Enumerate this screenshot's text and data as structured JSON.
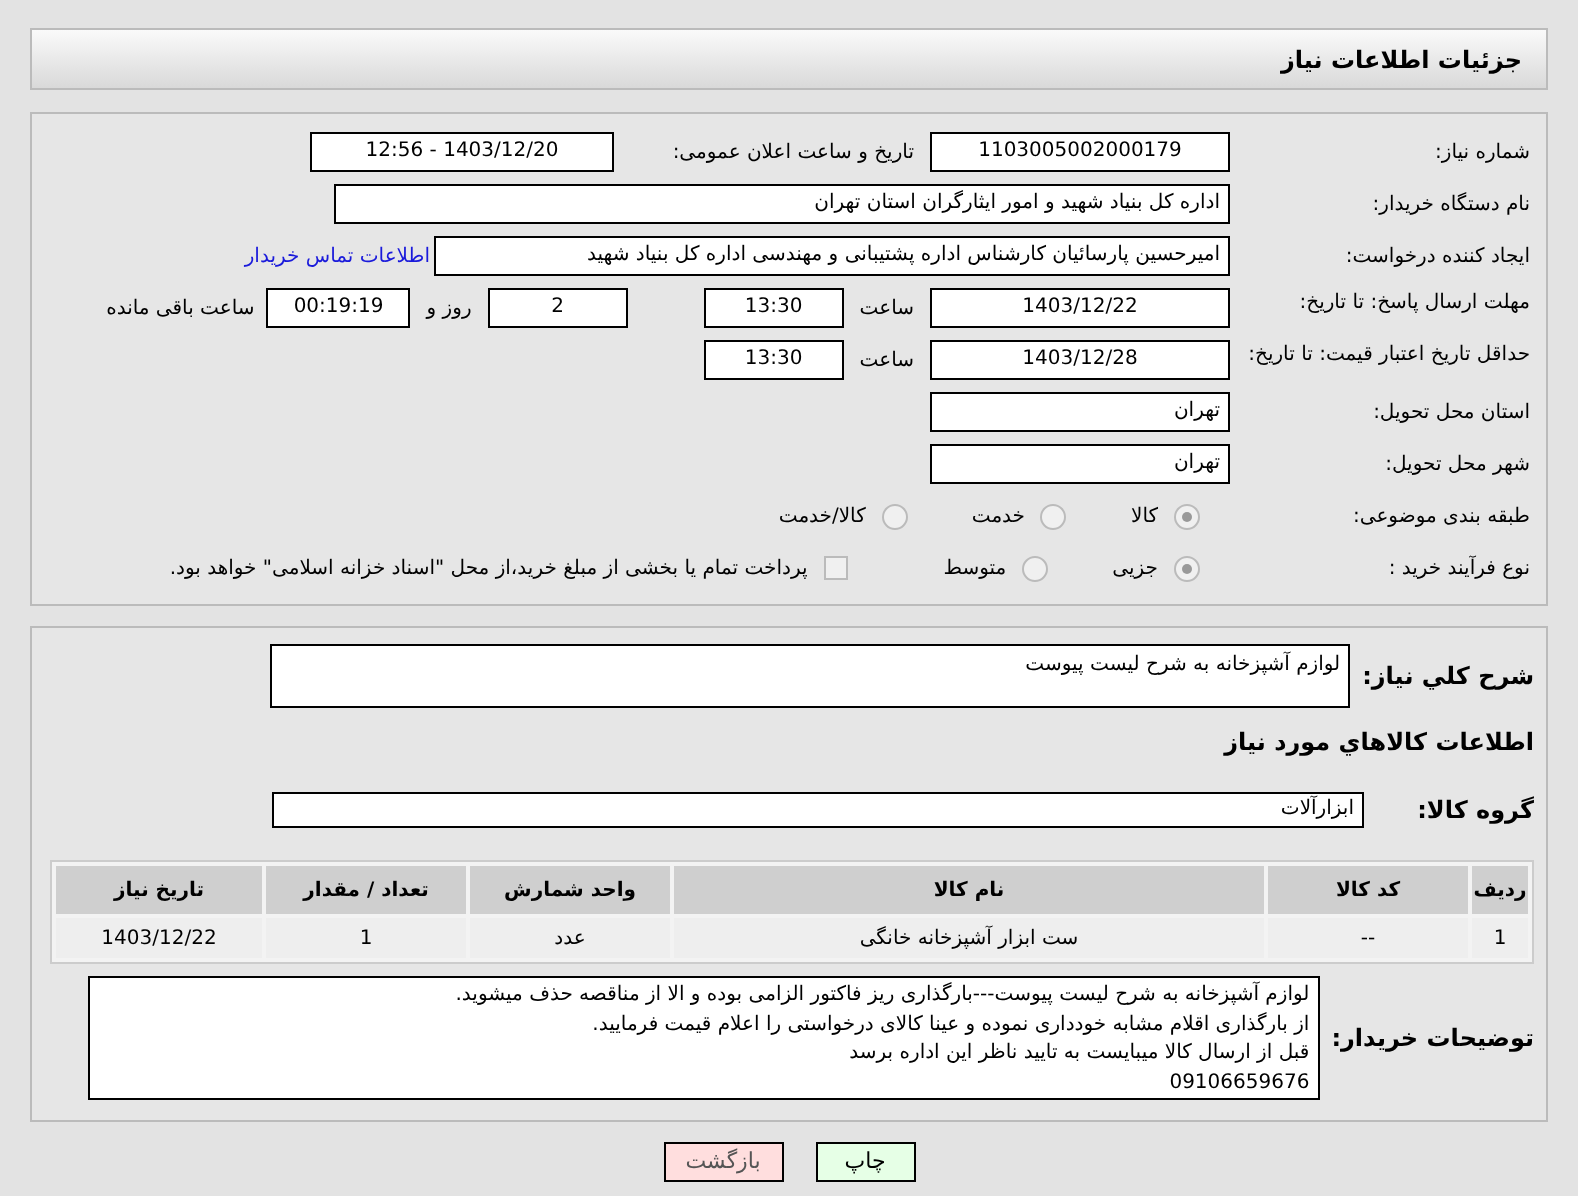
{
  "header": {
    "title": "جزئیات اطلاعات نیاز"
  },
  "need_number": {
    "label": "شماره نیاز:",
    "value": "1103005002000179"
  },
  "announce": {
    "label": "تاریخ و ساعت اعلان عمومی:",
    "value": "1403/12/20 - 12:56"
  },
  "buyer": {
    "label": "نام دستگاه خریدار:",
    "value": "اداره کل بنیاد شهید و امور ایثارگران استان تهران"
  },
  "creator": {
    "label": "ایجاد کننده درخواست:",
    "value": "امیرحسین پارسائیان کارشناس اداره پشتیبانی و مهندسی  اداره کل بنیاد شهید",
    "link": "اطلاعات تماس خریدار"
  },
  "reply_deadline": {
    "label": "مهلت ارسال پاسخ: تا تاریخ:",
    "date": "1403/12/22",
    "time_label": "ساعت",
    "time": "13:30",
    "days": "2",
    "days_label": "روز و",
    "remaining": "00:19:19",
    "remaining_label": "ساعت باقی مانده"
  },
  "price_validity": {
    "label": "حداقل تاریخ اعتبار قیمت: تا تاریخ:",
    "date": "1403/12/28",
    "time_label": "ساعت",
    "time": "13:30"
  },
  "province": {
    "label": "استان محل تحویل:",
    "value": "تهران"
  },
  "city": {
    "label": "شهر محل تحویل:",
    "value": "تهران"
  },
  "category": {
    "label": "طبقه بندی موضوعی:",
    "options": [
      {
        "label": "کالا",
        "selected": true
      },
      {
        "label": "خدمت",
        "selected": false
      },
      {
        "label": "کالا/خدمت",
        "selected": false
      }
    ]
  },
  "purchase_process": {
    "label": "نوع فرآیند خرید :",
    "options": [
      {
        "label": "جزیی",
        "selected": true
      },
      {
        "label": "متوسط",
        "selected": false
      }
    ],
    "payment": {
      "label": "پرداخت تمام یا بخشی از مبلغ خرید،از محل \"اسناد خزانه اسلامی\" خواهد بود.",
      "checked": false
    }
  },
  "description": {
    "label": "شرح کلي نياز:",
    "value": "لوازم آشپزخانه به شرح لیست پیوست"
  },
  "goods_title": "اطلاعات کالاهاي مورد نياز",
  "goods_group": {
    "label": "گروه کالا:",
    "value": "ابزارآلات"
  },
  "table": {
    "columns": [
      "ردیف",
      "کد کالا",
      "نام کالا",
      "واحد شمارش",
      "تعداد / مقدار",
      "تاریخ نیاز"
    ],
    "rows": [
      [
        "1",
        "--",
        "ست ابزار آشپزخانه خانگی",
        "عدد",
        "1",
        "1403/12/22"
      ]
    ]
  },
  "buyer_notes": {
    "label": "توضیحات خریدار:",
    "lines": [
      "لوازم آشپزخانه به شرح لیست پیوست---بارگذاری ریز فاکتور الزامی بوده و الا از مناقصه حذف میشوید.",
      "از بارگذاری اقلام مشابه خودداری نموده و عینا کالای درخواستی را اعلام قیمت فرمایید.",
      "قبل از ارسال کالا میبایست به تایید ناظر این اداره برسد",
      "09106659676"
    ]
  },
  "buttons": [
    {
      "label": "چاپ",
      "kind": "print"
    },
    {
      "label": "بازگشت",
      "kind": "back"
    }
  ]
}
